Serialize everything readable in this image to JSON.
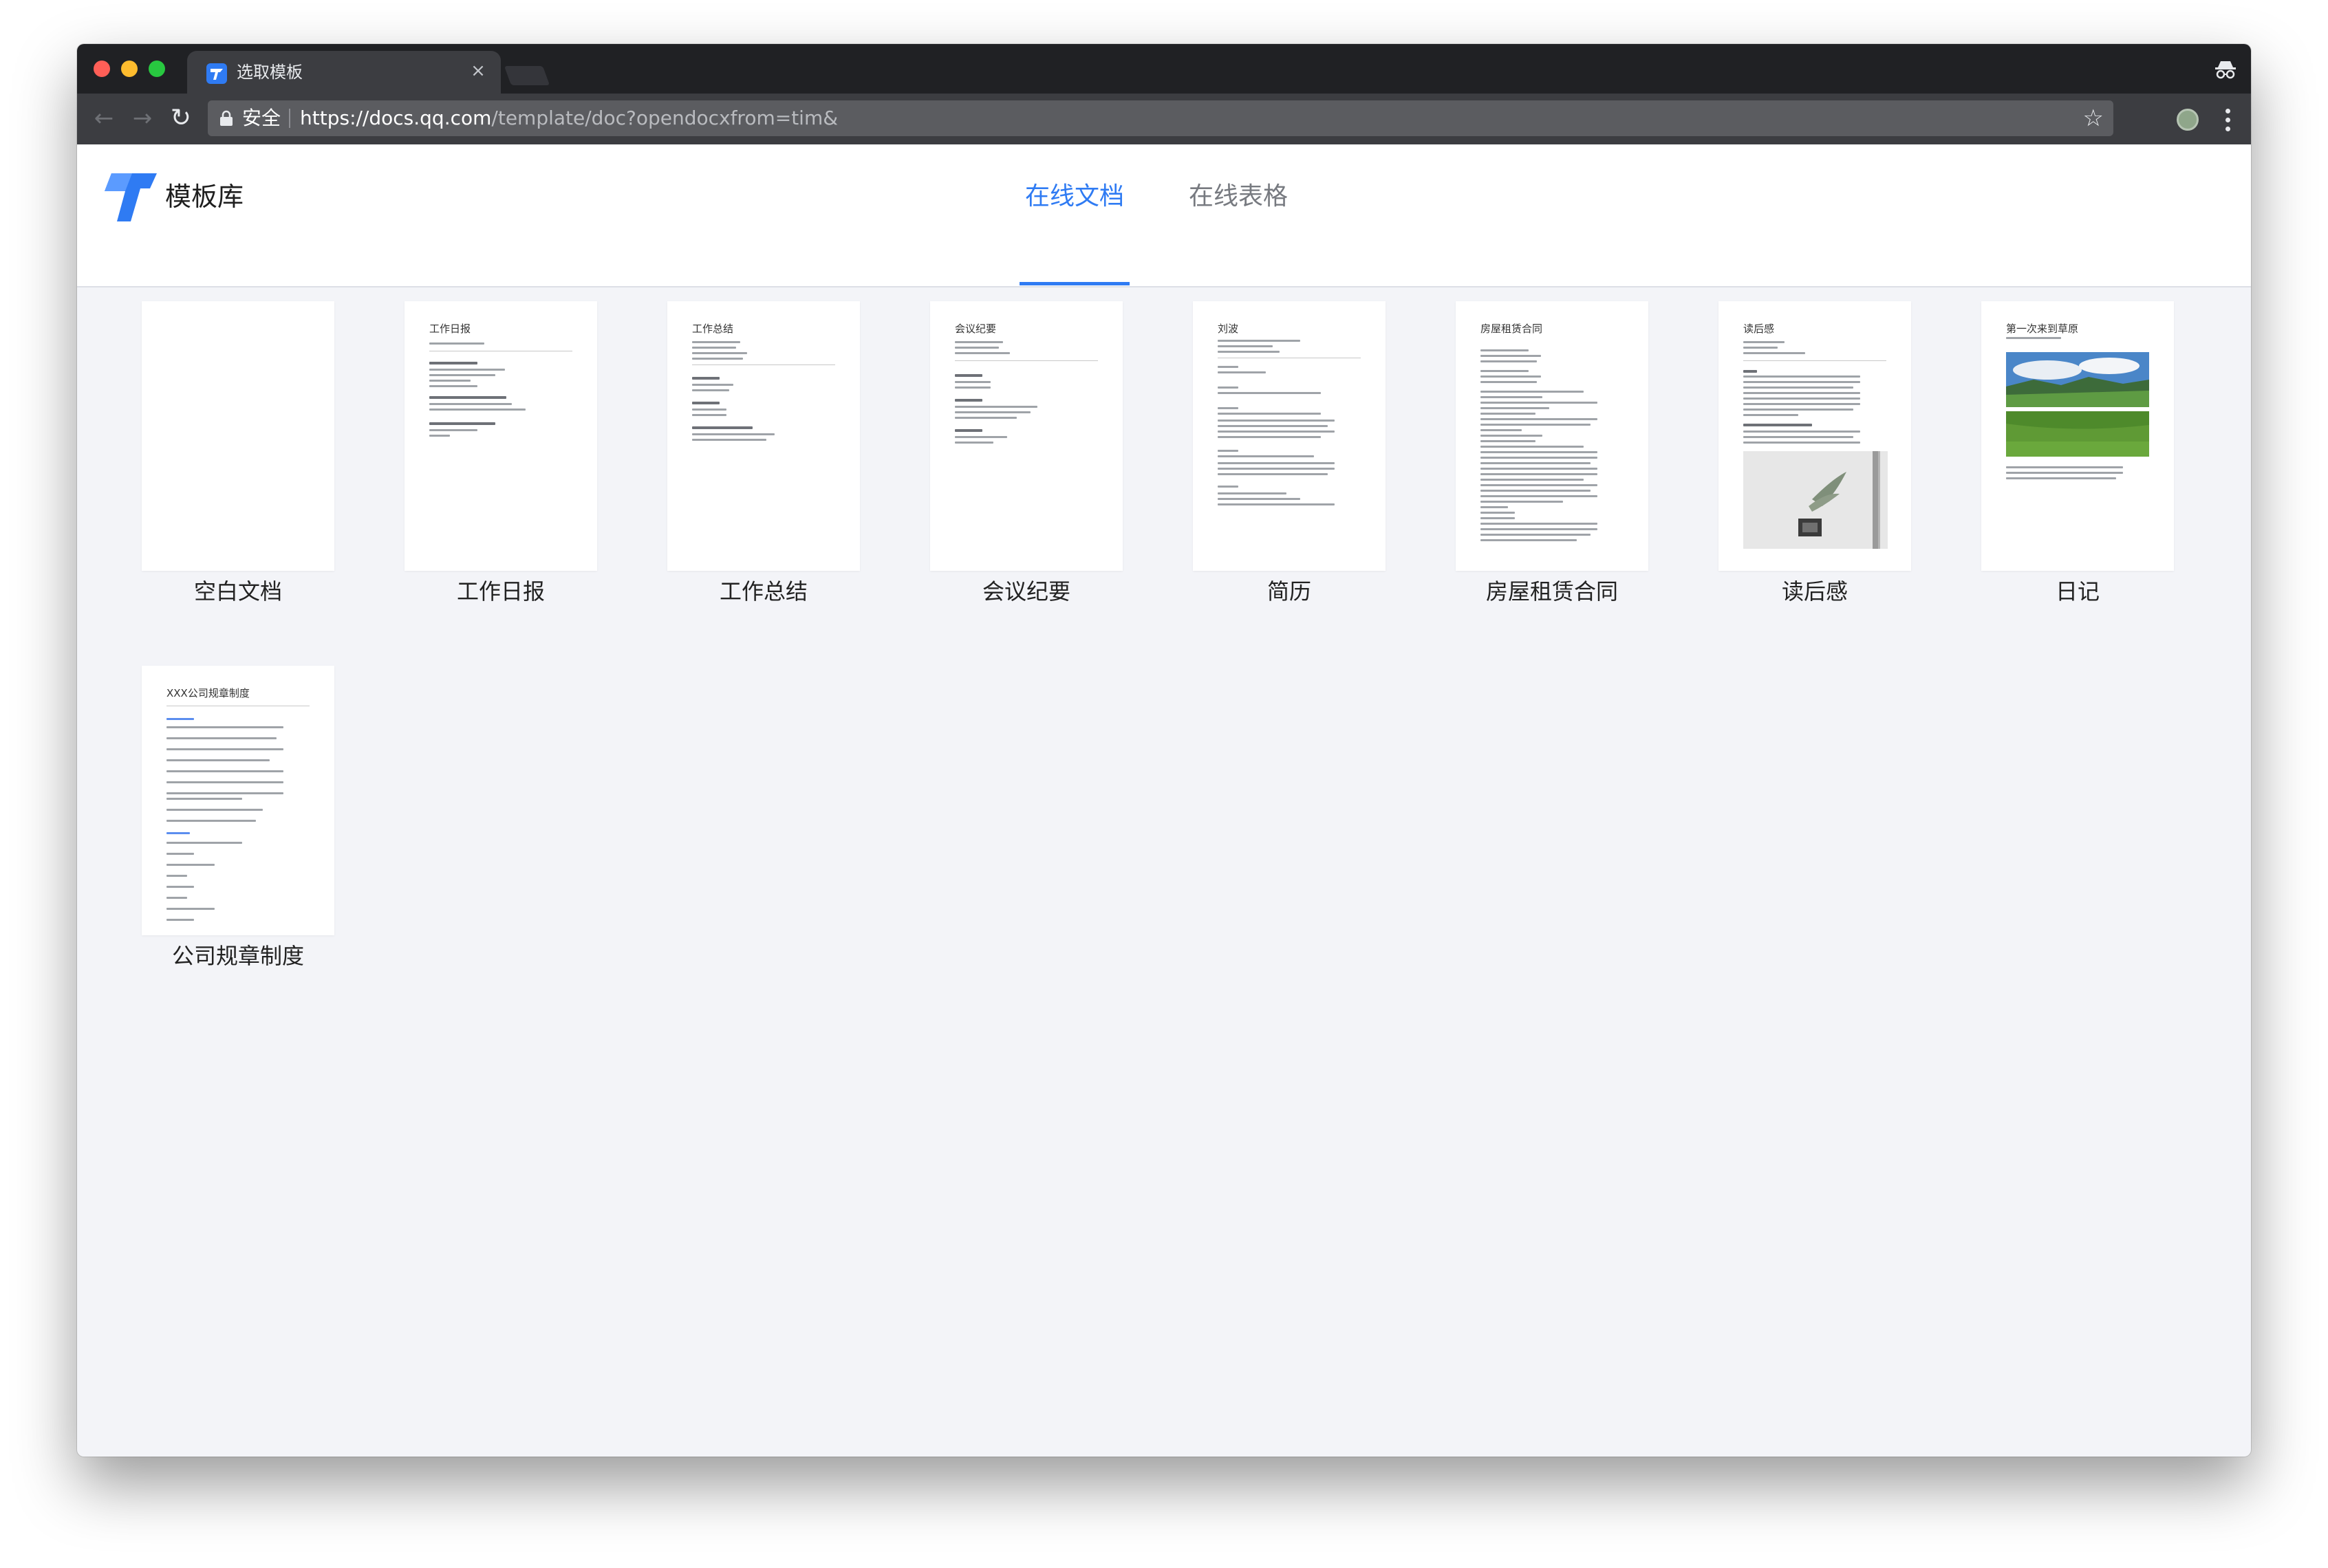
{
  "browser": {
    "tab_title": "选取模板",
    "tab_close": "×",
    "secure_label": "安全",
    "url_host": "https://docs.qq.com",
    "url_path": "/template/doc?opendocxfrom=tim&",
    "star": "☆"
  },
  "header": {
    "brand": "模板库",
    "tabs": [
      {
        "label": "在线文档",
        "active": true
      },
      {
        "label": "在线表格",
        "active": false
      }
    ]
  },
  "templates": [
    {
      "label": "空白文档",
      "doc_title": ""
    },
    {
      "label": "工作日报",
      "doc_title": "工作日报"
    },
    {
      "label": "工作总结",
      "doc_title": "工作总结"
    },
    {
      "label": "会议纪要",
      "doc_title": "会议纪要"
    },
    {
      "label": "简历",
      "doc_title": "刘波"
    },
    {
      "label": "房屋租赁合同",
      "doc_title": "房屋租赁合同"
    },
    {
      "label": "读后感",
      "doc_title": "读后感"
    },
    {
      "label": "日记",
      "doc_title": "第一次来到草原"
    },
    {
      "label": "公司规章制度",
      "doc_title": "XXX公司规章制度"
    }
  ],
  "colors": {
    "accent": "#2f7bf3",
    "page_bg": "#f3f4f8",
    "titlebar": "#202124",
    "toolbar": "#3c3d41"
  }
}
